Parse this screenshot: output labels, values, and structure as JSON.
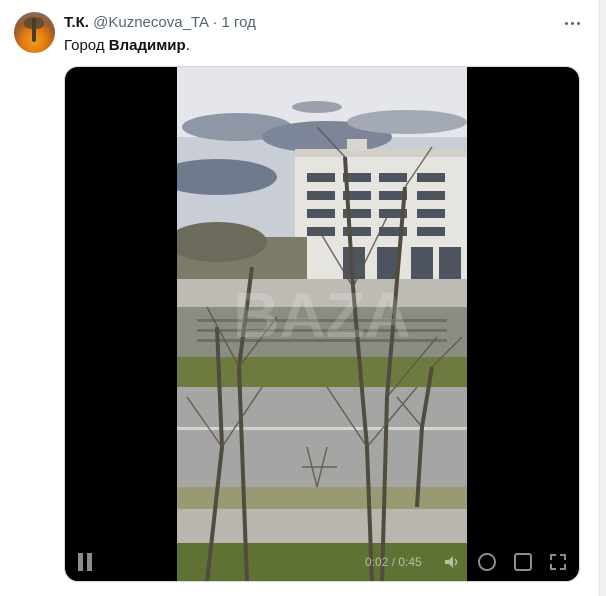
{
  "tweet": {
    "name": "Т.К.",
    "handle": "@Kuznecova_TA",
    "separator": "·",
    "time": "1 год",
    "text_plain": "Город ",
    "text_bold": "Владимир",
    "text_end": "."
  },
  "video": {
    "watermark": "BAZA",
    "timecode": "0:02 / 0:45"
  },
  "icons": {
    "more": "more-dots-icon",
    "pause": "pause-icon",
    "volume": "volume-icon",
    "settings": "gear-icon",
    "popout": "popout-icon",
    "fullscreen": "fullscreen-icon"
  }
}
